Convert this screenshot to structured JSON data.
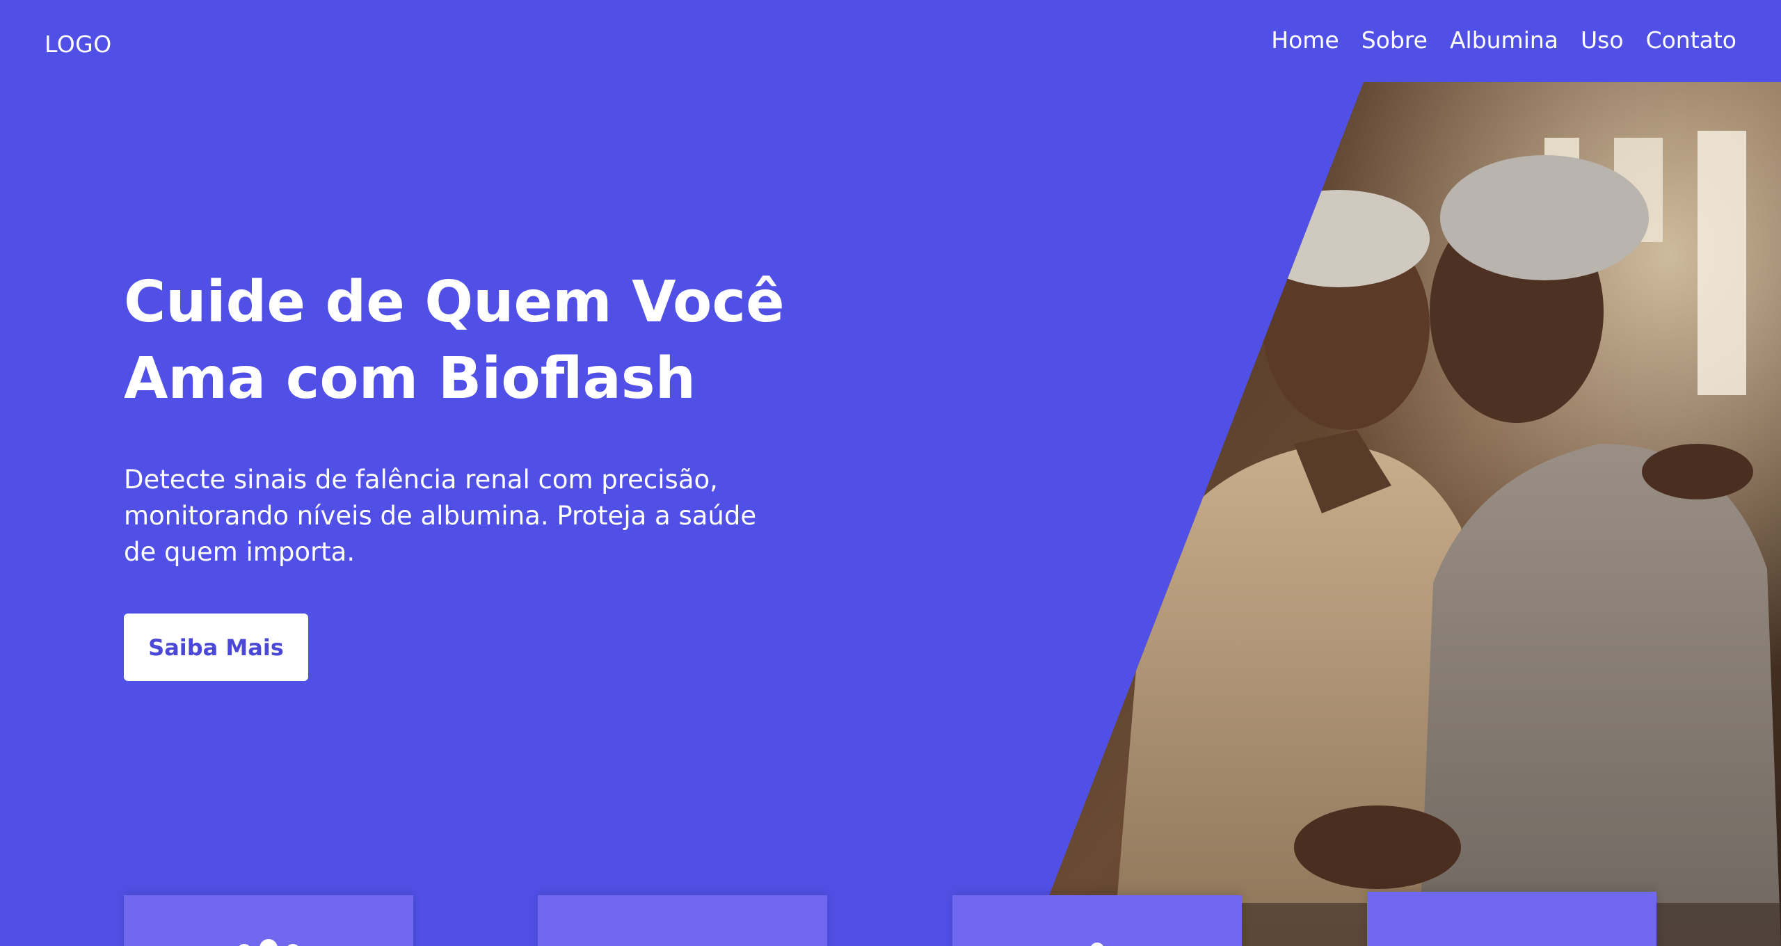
{
  "header": {
    "logo": "LOGO",
    "nav": [
      "Home",
      "Sobre",
      "Albumina",
      "Uso",
      "Contato"
    ]
  },
  "hero": {
    "title_lines": [
      "Cuide de Quem Você",
      "Ama com Bioflash"
    ],
    "subtitle_lines": [
      "Detecte sinais de falência renal com precisão,",
      "monitorando níveis de albumina. Proteja a saúde",
      "de quem importa."
    ],
    "cta_label": "Saiba Mais",
    "image_description": "Two smiling elderly women embracing, sitting on a couch in a warm living room"
  },
  "cards": [
    {
      "icon": "group-icon"
    },
    {
      "icon": "chart-icon"
    },
    {
      "icon": "person-icon"
    },
    {
      "icon": "heart-icon"
    }
  ],
  "colors": {
    "background": "#5050E6",
    "card": "#7069F0",
    "button_text": "#4B48D8",
    "text": "#FFFFFF"
  }
}
